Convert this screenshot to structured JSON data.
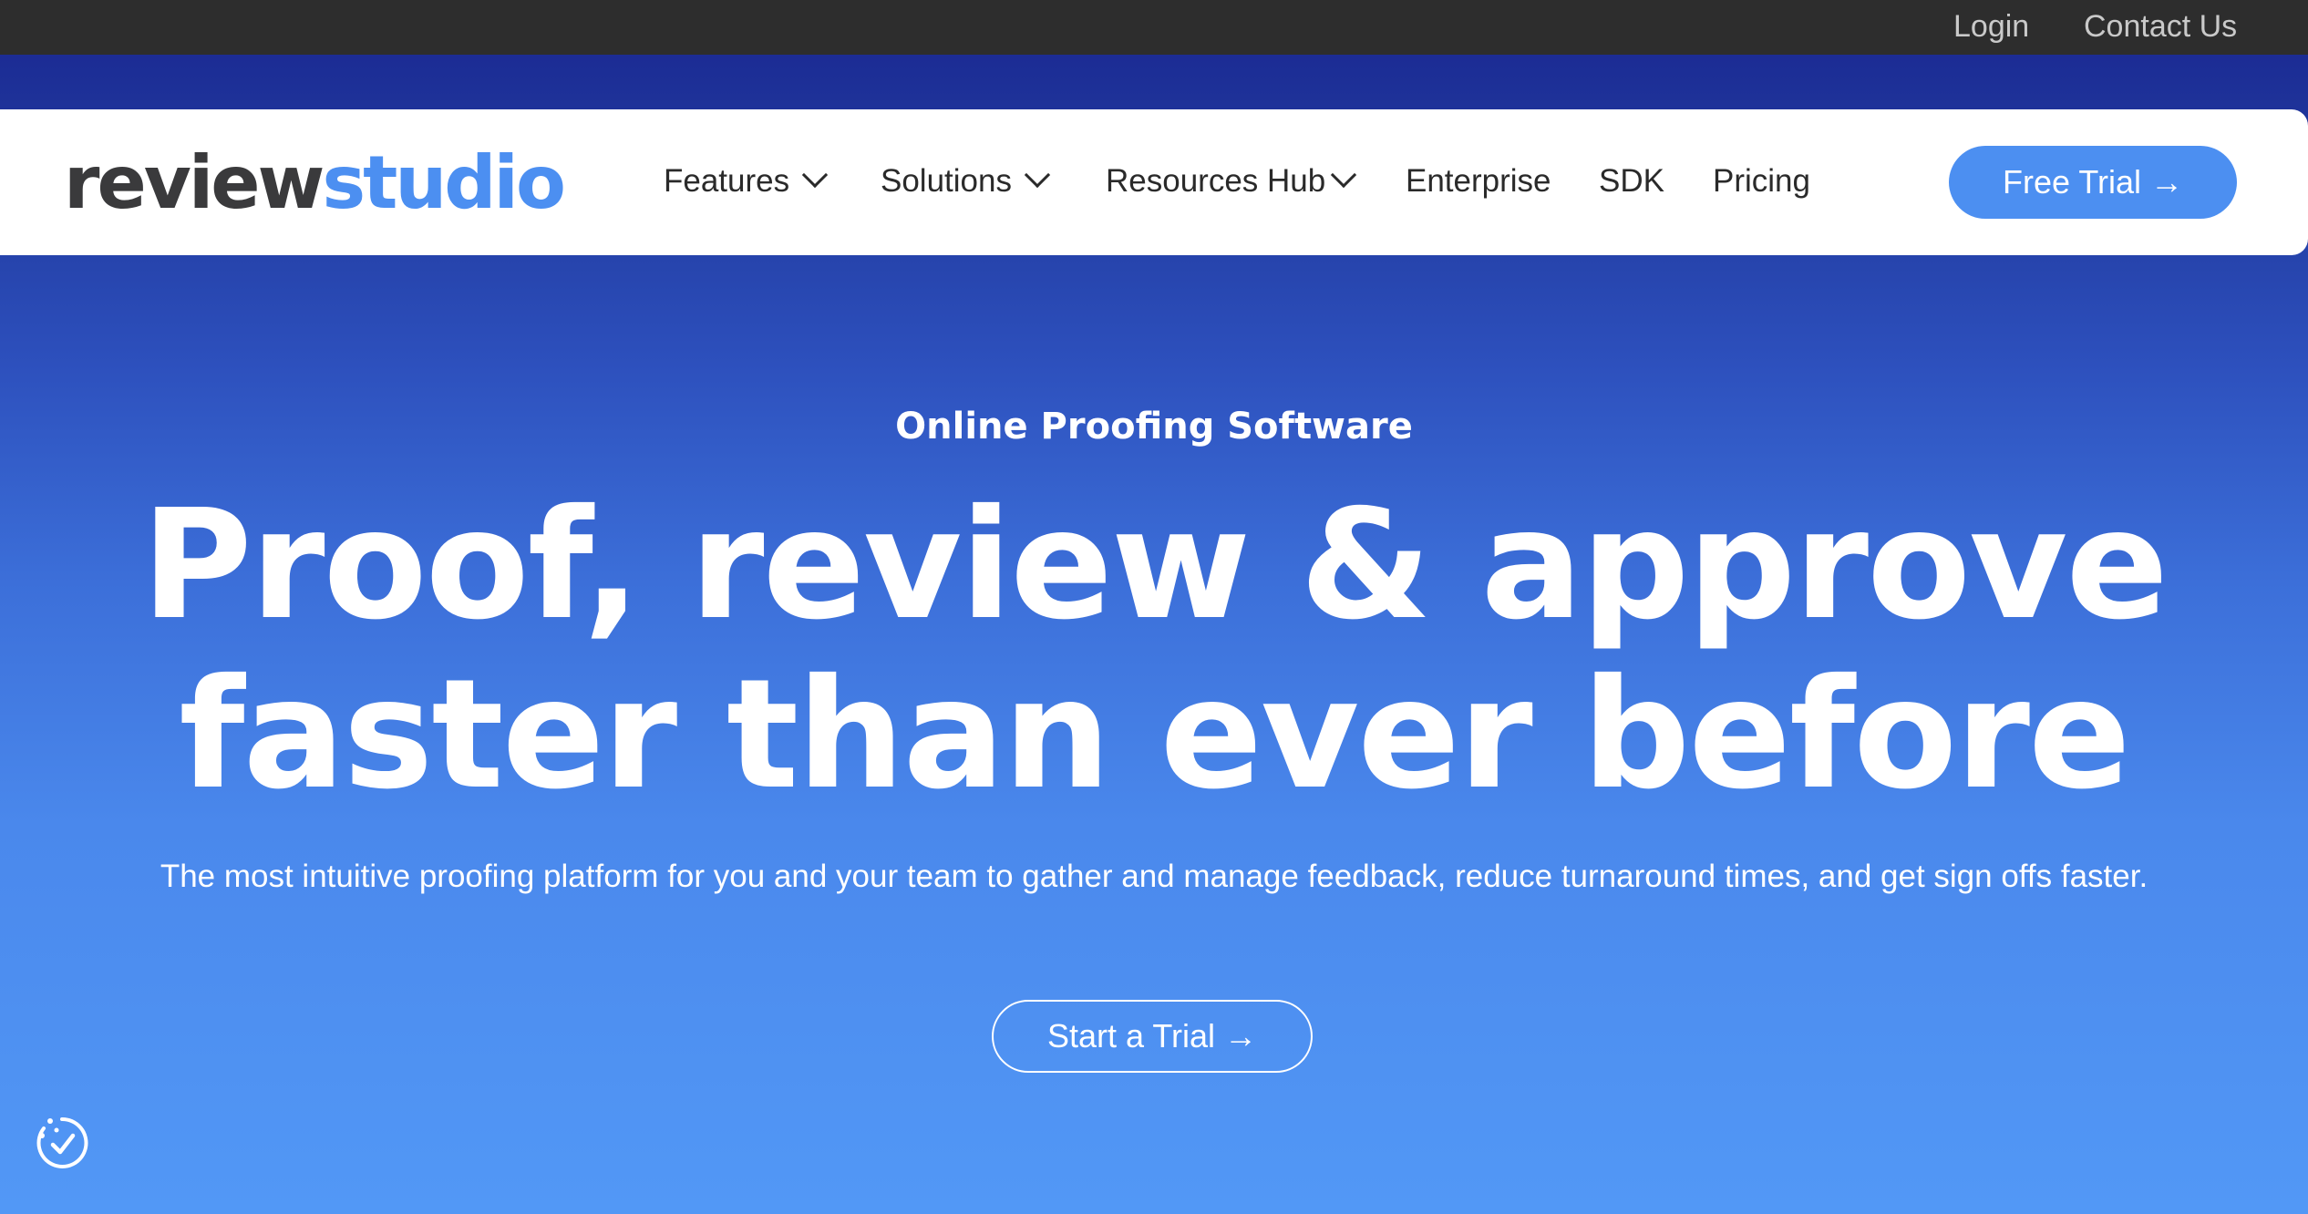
{
  "topbar": {
    "login": "Login",
    "contact": "Contact Us"
  },
  "logo": {
    "part1": "review",
    "part2": "studio"
  },
  "nav": {
    "features": "Features",
    "solutions": "Solutions",
    "resources": "Resources Hub",
    "enterprise": "Enterprise",
    "sdk": "SDK",
    "pricing": "Pricing",
    "free_trial": "Free Trial →"
  },
  "hero": {
    "eyebrow": "Online Proofing Software",
    "headline_line1": "Proof, review & approve",
    "headline_line2": "faster than ever before",
    "subtext": "The most intuitive proofing platform for you and your team to gather and manage feedback, reduce turnaround times, and get sign offs faster.",
    "cta": "Start a Trial →"
  },
  "icons": {
    "badge": "accessibility-check-icon",
    "chevron": "chevron-down-icon"
  },
  "colors": {
    "brand_blue": "#4c8ff1",
    "topbar_bg": "#2d2d2d",
    "hero_top": "#19258f",
    "hero_bottom": "#5298f6"
  }
}
